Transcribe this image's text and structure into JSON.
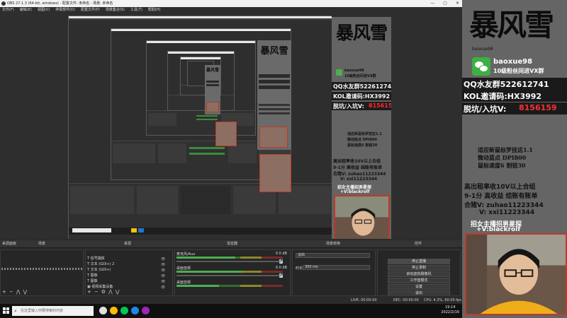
{
  "window": {
    "title": "OBS 27.1.3 (64-bit, windows) - 配置文件: 未命名 - 场景: 未命名",
    "controls": [
      "—",
      "▢",
      "✕"
    ]
  },
  "menu": [
    "文件(F)",
    "编辑(E)",
    "视图(V)",
    "停靠部件(D)",
    "配置文件(P)",
    "场景集合(S)",
    "工具(T)",
    "帮助(H)"
  ],
  "capture": {
    "logo": "暴风雪",
    "id": "baoxue98",
    "group": "10级粉丝间进VX群",
    "qq": "QQ水友群522612741",
    "kol": "KOL邀请码:HX3992",
    "pit": "脱坑/入坑V:",
    "pit_num": "8156159",
    "tips": [
      "适应新鼠标罗技这1.1",
      "微动蓝点 DPI800",
      "鼠标速度6 割锐30"
    ],
    "promo": [
      "高出租率收10V以上合组",
      "9-1分 高收益 结账有账单",
      "合猪V: zuhao11223344",
      "V: xxi11223344"
    ],
    "recruit": "招女主播招男星探",
    "recruit_v": "+V:blackrolf"
  },
  "docks": {
    "tabs": [
      "来源面板",
      "场景",
      "来源",
      "混音器",
      "场景转换",
      "控件"
    ],
    "scene_filter_placeholder": "",
    "sources": [
      {
        "label": "信号捕获"
      },
      {
        "label": "文本 (GDI+) 2"
      },
      {
        "label": "文本 (GDI+)"
      },
      {
        "label": "图像"
      },
      {
        "label": "图像"
      },
      {
        "label": "视频采集设备"
      }
    ],
    "mixer": [
      {
        "label": "麦克风/Aux",
        "db": "0.0 dB",
        "level": 0.55
      },
      {
        "label": "桌面音频",
        "db": "0.0 dB",
        "level": 0.62
      },
      {
        "label": "桌面音频",
        "db": "0.0 dB",
        "level": 0.4
      }
    ],
    "transition": {
      "type": "淡出",
      "duration_label": "时长",
      "duration": "300 ms"
    },
    "controls": [
      "停止直播",
      "停止录制",
      "启动虚拟摄像机",
      "工作室模式",
      "设置",
      "退出"
    ],
    "status": {
      "live": "LIVE: 00:00:00",
      "rec": "REC: 00:00:00",
      "cpu": "CPU: 4.3%, 60.00 fps"
    }
  },
  "taskbar": {
    "search_placeholder": "在这里输入你要搜索的内容",
    "time": "19:14",
    "date": "2022/2/16",
    "apps": [
      {
        "name": "obs-app-icon",
        "color": "#e0e0e0"
      },
      {
        "name": "chrome-icon",
        "color": "#fbbc05"
      },
      {
        "name": "edge-icon",
        "color": "#1e88e5"
      },
      {
        "name": "game-icon",
        "color": "#9c27b0"
      },
      {
        "name": "steam-icon",
        "color": "#00c853"
      }
    ]
  },
  "overlay": {
    "logo": "暴风雪",
    "sub": "baoxue98",
    "id": "baoxue98",
    "group": "10级粉丝间进VX群",
    "qq": "QQ水友群522612741",
    "kol": "KOL邀请码:HX3992",
    "pit": "脱坑/入坑V:",
    "pit_num": "8156159",
    "tips": [
      "适应新鼠标罗技这1.1",
      "微动蓝点  DPI800",
      "鼠标速度6  割锐30"
    ],
    "promo": [
      "高出租率收10V以上合组",
      "9-1分 高收益 结账有账单",
      "合猪V:  zuhao11223344",
      "V:  xxi11223344"
    ],
    "recruit": "招女主播招男星探",
    "recruit_v": "+V:blackrolf"
  },
  "colors": {
    "accent_red": "#ff3030",
    "obs_bg": "#2b2b2b",
    "wechat_green": "#3cb043",
    "frame_red": "#c0392b"
  }
}
